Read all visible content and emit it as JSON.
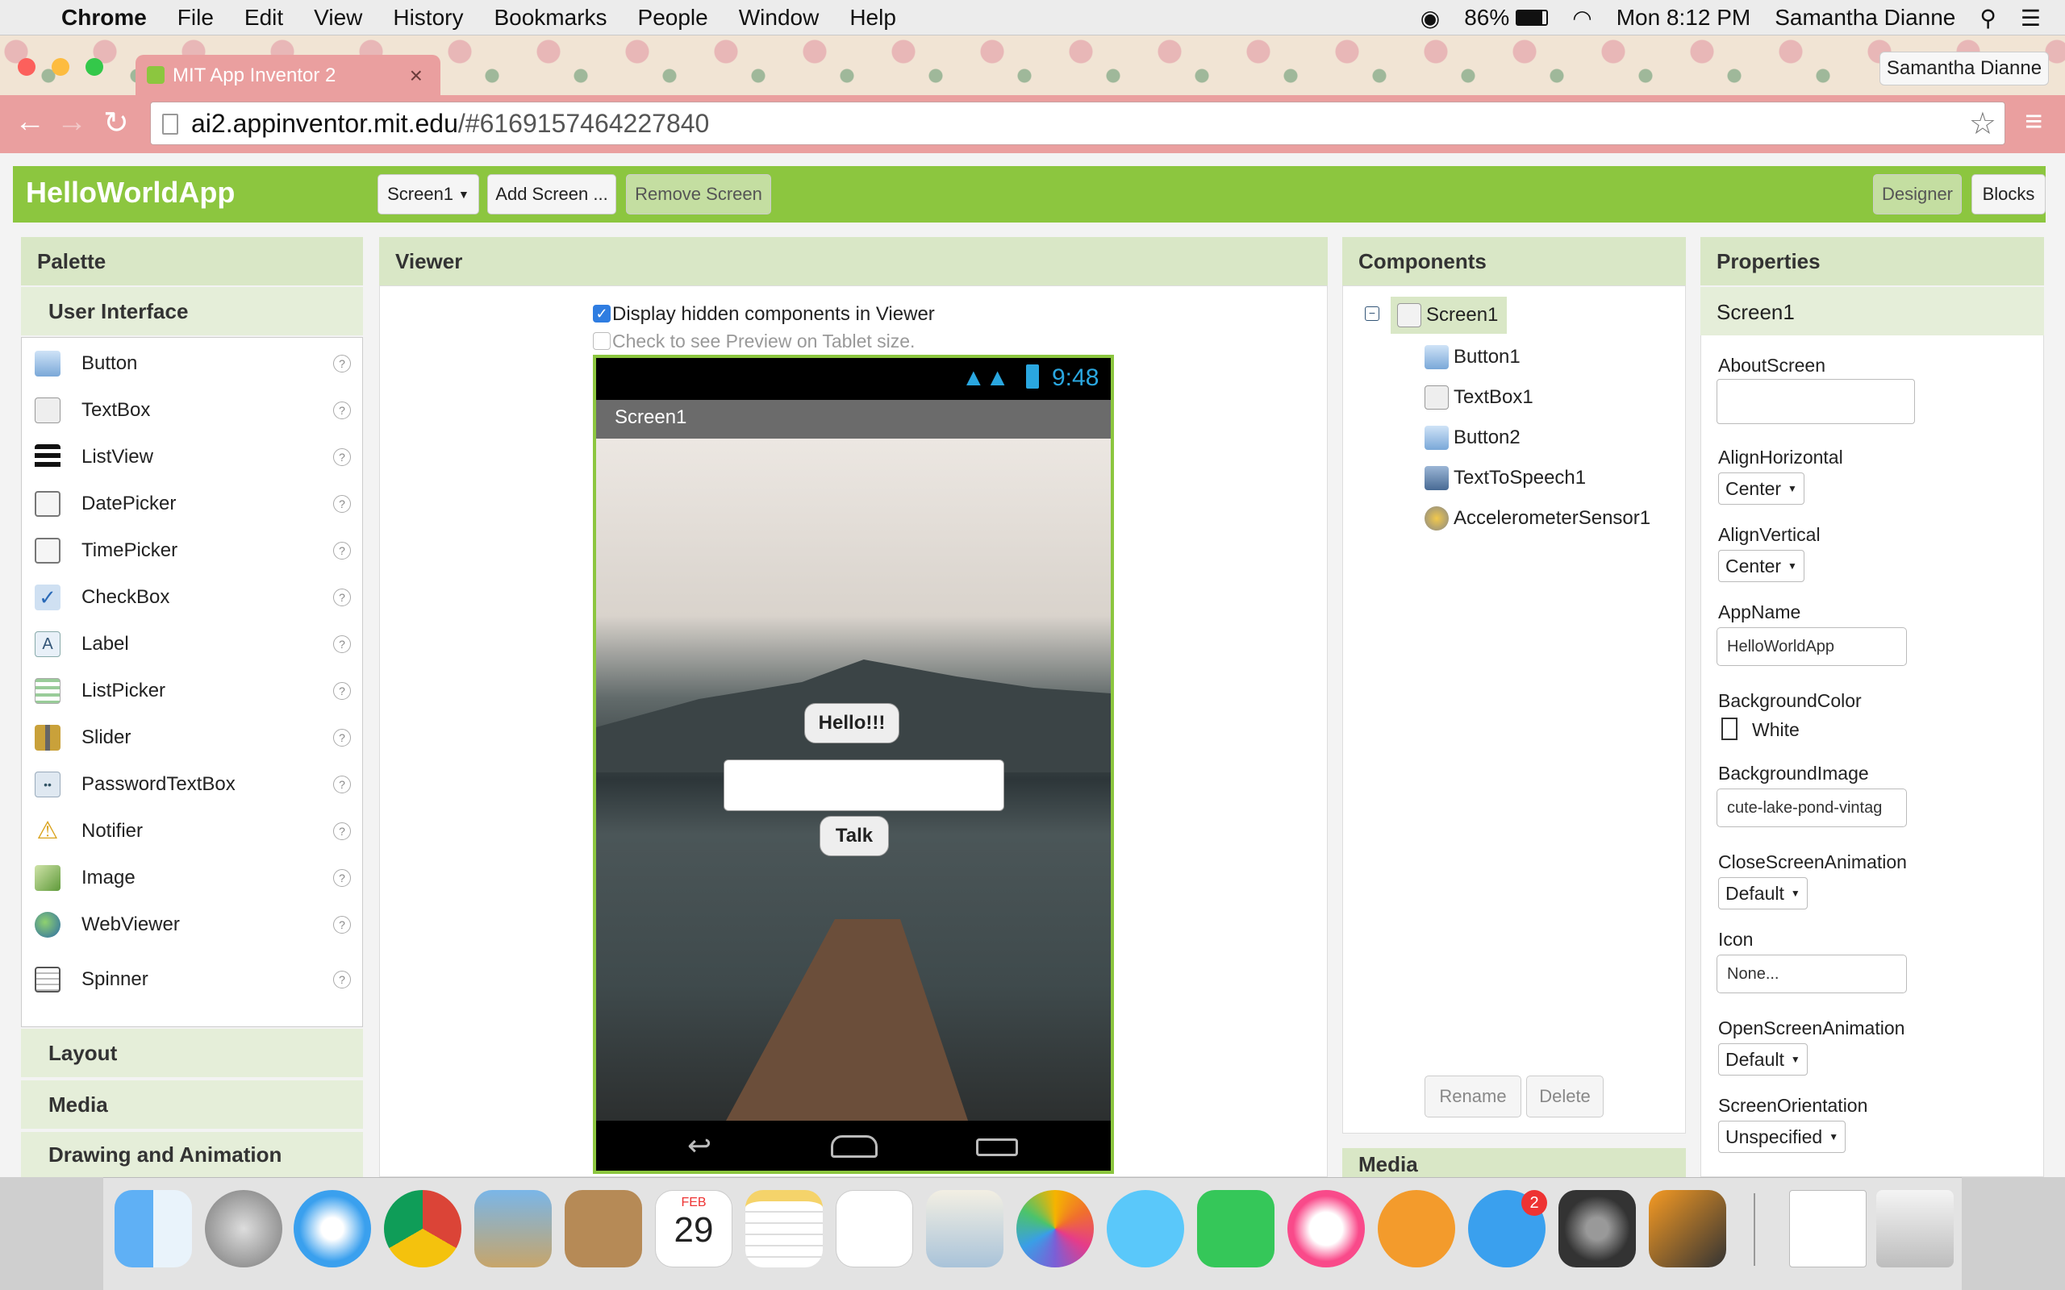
{
  "menubar": {
    "apple": "",
    "app": "Chrome",
    "items": [
      "File",
      "Edit",
      "View",
      "History",
      "Bookmarks",
      "People",
      "Window",
      "Help"
    ],
    "battery": "86%",
    "clock": "Mon 8:12 PM",
    "user": "Samantha Dianne"
  },
  "browser": {
    "tab_title": "MIT App Inventor 2",
    "tab_close": "×",
    "profile": "Samantha Dianne",
    "url_host": "ai2.appinventor.mit.edu",
    "url_path": "/#6169157464227840"
  },
  "app": {
    "name": "HelloWorldApp",
    "screen_select": "Screen1",
    "add_screen": "Add Screen ...",
    "remove_screen": "Remove Screen",
    "designer": "Designer",
    "blocks": "Blocks"
  },
  "palette": {
    "title": "Palette",
    "section": "User Interface",
    "items": [
      "Button",
      "TextBox",
      "ListView",
      "DatePicker",
      "TimePicker",
      "CheckBox",
      "Label",
      "ListPicker",
      "Slider",
      "PasswordTextBox",
      "Notifier",
      "Image",
      "WebViewer",
      "Spinner"
    ],
    "help": "?",
    "more_sections": [
      "Layout",
      "Media",
      "Drawing and Animation"
    ]
  },
  "viewer": {
    "title": "Viewer",
    "hidden_check": "Display hidden components in Viewer",
    "tablet_check": "Check to see Preview on Tablet size.",
    "phone_time": "9:48",
    "screen_title": "Screen1",
    "hello_btn": "Hello!!!",
    "talk_btn": "Talk"
  },
  "components": {
    "title": "Components",
    "root": "Screen1",
    "children": [
      "Button1",
      "TextBox1",
      "Button2",
      "TextToSpeech1",
      "AccelerometerSensor1"
    ],
    "rename": "Rename",
    "delete": "Delete",
    "media_title": "Media"
  },
  "properties": {
    "title": "Properties",
    "screen": "Screen1",
    "about_label": "AboutScreen",
    "align_h_label": "AlignHorizontal",
    "align_h": "Center",
    "align_v_label": "AlignVertical",
    "align_v": "Center",
    "appname_label": "AppName",
    "appname": "HelloWorldApp",
    "bgcolor_label": "BackgroundColor",
    "bgcolor": "White",
    "bgimage_label": "BackgroundImage",
    "bgimage": "cute-lake-pond-vintag",
    "close_anim_label": "CloseScreenAnimation",
    "close_anim": "Default",
    "icon_label": "Icon",
    "icon": "None...",
    "open_anim_label": "OpenScreenAnimation",
    "open_anim": "Default",
    "orientation_label": "ScreenOrientation",
    "orientation": "Unspecified"
  },
  "dock": {
    "calendar_month": "FEB",
    "calendar_day": "29",
    "appstore_badge": "2"
  }
}
